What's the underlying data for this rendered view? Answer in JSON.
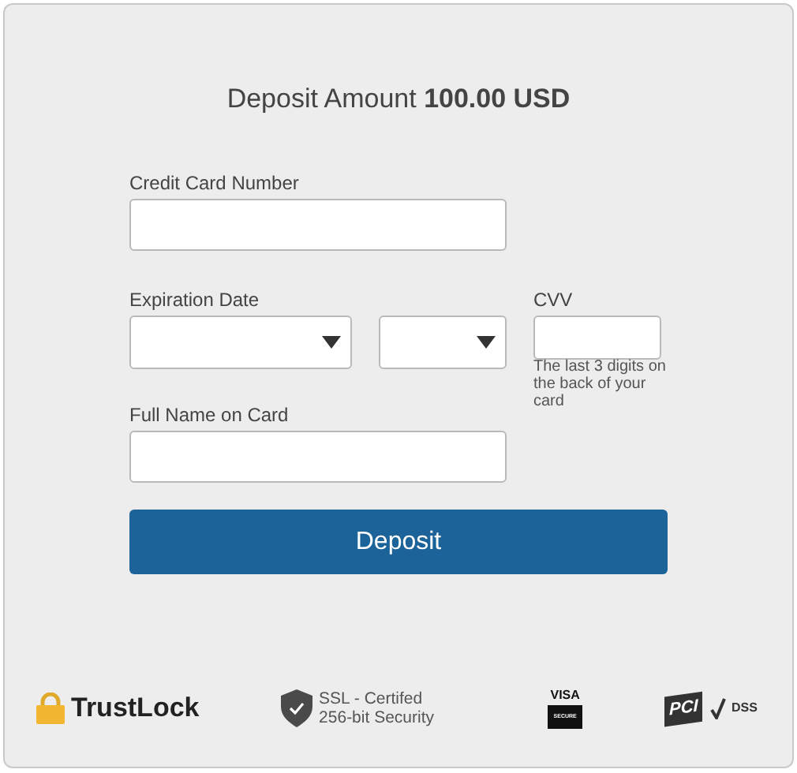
{
  "title": {
    "prefix": "Deposit Amount",
    "amount": "100.00 USD"
  },
  "card_number": {
    "label": "Credit Card Number"
  },
  "expiration": {
    "label": "Expiration Date",
    "selects": [
      {
        "kind": "month"
      },
      {
        "kind": "year"
      }
    ]
  },
  "cvv": {
    "label": "CVV",
    "help": "The last 3 digits on the back of your card"
  },
  "full_name": {
    "label": "Full Name on Card"
  },
  "submit": {
    "label": "Deposit"
  },
  "badges": [
    {
      "kind": "trustlock",
      "texts": [
        "TrustLock"
      ]
    },
    {
      "kind": "ssl",
      "texts": [
        "SSL - Certifed",
        "256-bit Security"
      ]
    },
    {
      "kind": "visa",
      "texts": [
        "VISA",
        "SECURE"
      ]
    },
    {
      "kind": "pci",
      "texts": [
        "PCI",
        "DSS"
      ]
    }
  ]
}
